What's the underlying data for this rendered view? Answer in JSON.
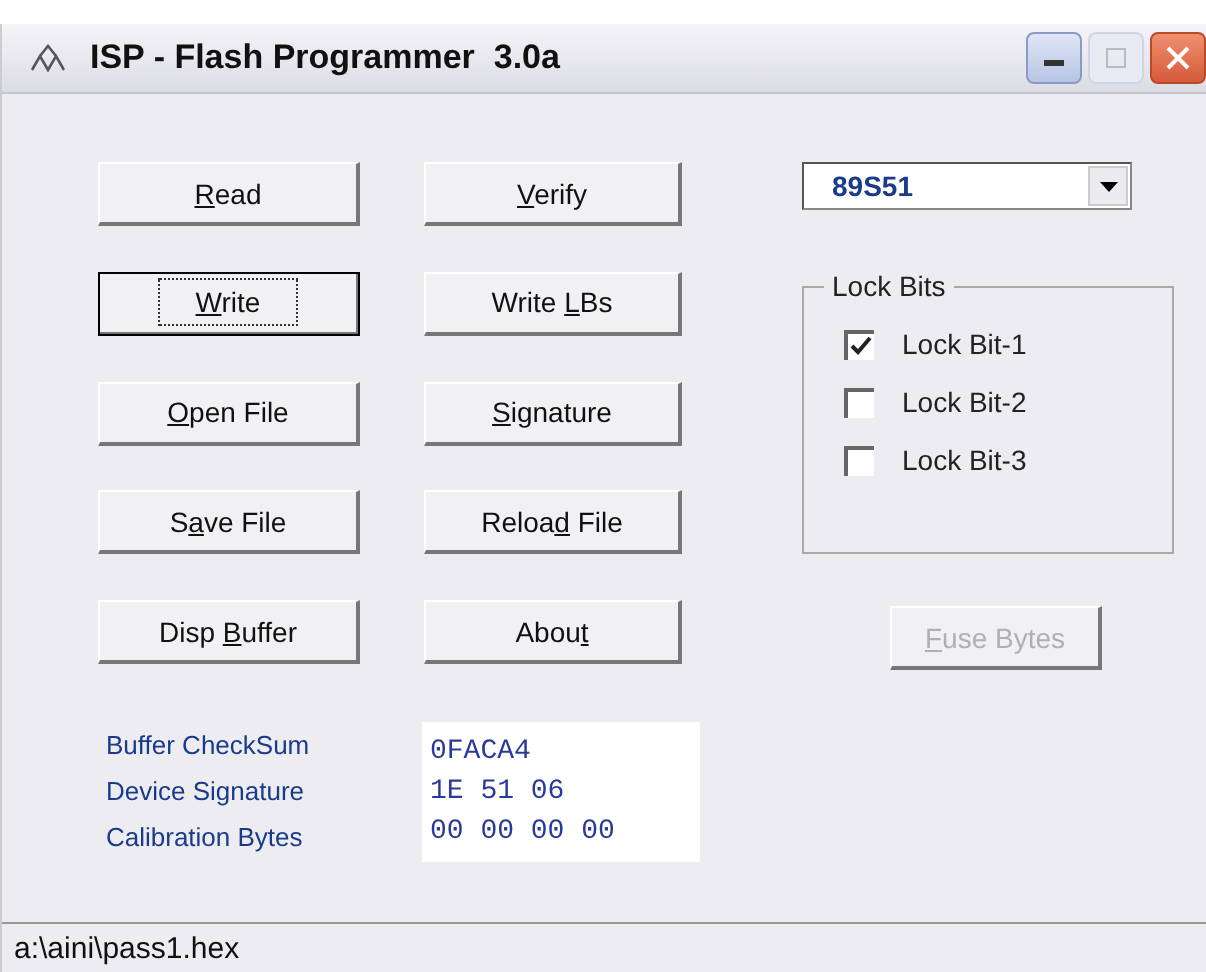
{
  "window": {
    "title": "ISP - Flash Programmer  3.0a"
  },
  "buttons": [
    {
      "key": "R",
      "post": "ead",
      "focused": false,
      "disabled": false
    },
    {
      "key": "V",
      "post": "erify",
      "focused": false,
      "disabled": false
    },
    {
      "key": "W",
      "post": "rite",
      "focused": true,
      "disabled": false
    },
    {
      "pre": "Write ",
      "key": "L",
      "post": "Bs",
      "focused": false,
      "disabled": false
    },
    {
      "key": "O",
      "post": "pen File",
      "focused": false,
      "disabled": false
    },
    {
      "key": "S",
      "post": "ignature",
      "focused": false,
      "disabled": false
    },
    {
      "pre": "S",
      "key": "a",
      "post": "ve File",
      "focused": false,
      "disabled": false
    },
    {
      "pre": "Reloa",
      "key": "d",
      "post": " File",
      "focused": false,
      "disabled": false
    },
    {
      "pre": "Disp ",
      "key": "B",
      "post": "uffer",
      "focused": false,
      "disabled": false
    },
    {
      "pre": "Abou",
      "key": "t",
      "focused": false,
      "disabled": false
    }
  ],
  "device_select": {
    "value": "89S51"
  },
  "lock_bits": {
    "title": "Lock Bits",
    "items": [
      {
        "label": "Lock Bit-1",
        "checked": true
      },
      {
        "label": "Lock Bit-2",
        "checked": false
      },
      {
        "label": "Lock Bit-3",
        "checked": false
      }
    ]
  },
  "fuse_button": {
    "key": "F",
    "post": "use Bytes",
    "focused": false,
    "disabled": true
  },
  "info": [
    {
      "label": "Buffer CheckSum",
      "value": "0FACA4"
    },
    {
      "label": "Device Signature",
      "value": "1E 51 06"
    },
    {
      "label": "Calibration Bytes",
      "value": "00 00 00 00"
    }
  ],
  "status_bar": {
    "path": "a:\\aini\\pass1.hex"
  }
}
